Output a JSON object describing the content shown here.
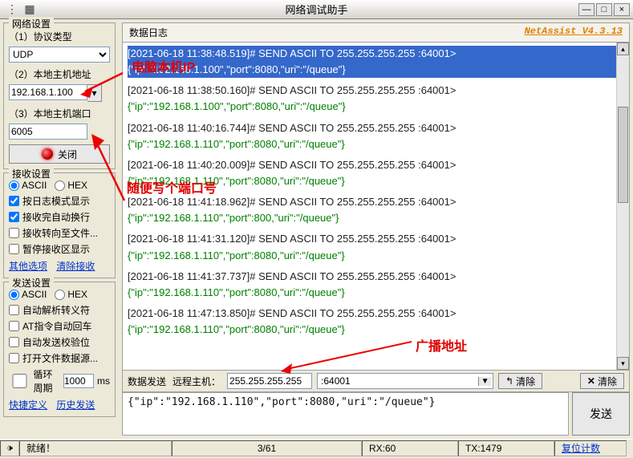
{
  "window": {
    "title": "网络调试助手",
    "brand": "NetAssist  V4.3.13"
  },
  "winbtns": {
    "min": "—",
    "max": "□",
    "close": "×"
  },
  "net_settings": {
    "title": "网络设置",
    "proto_label": "（1）协议类型",
    "proto_value": "UDP",
    "host_label": "（2）本地主机地址",
    "host_value": "192.168.1.100",
    "port_label": "（3）本地主机端口",
    "port_value": "6005",
    "btn_close": "关闭"
  },
  "recv_settings": {
    "title": "接收设置",
    "ascii": "ASCII",
    "hex": "HEX",
    "c1": "按日志模式显示",
    "c2": "接收完自动换行",
    "c3": "接收转向至文件...",
    "c4": "暂停接收区显示",
    "link_other": "其他选项",
    "link_clear": "清除接收"
  },
  "send_settings": {
    "title": "发送设置",
    "ascii": "ASCII",
    "hex": "HEX",
    "c1": "自动解析转义符",
    "c2": "AT指令自动回车",
    "c3": "自动发送校验位",
    "c4": "打开文件数据源...",
    "cycle_label": "循环周期",
    "cycle_val": "1000",
    "cycle_unit": "ms",
    "link_short": "快捷定义",
    "link_hist": "历史发送"
  },
  "log": {
    "tab": "数据日志",
    "entries": [
      {
        "t": "[2021-06-18 11:38:48.519]# SEND ASCII TO 255.255.255.255 :64001>",
        "b": "{\"ip\":\"192.168.1.100\",\"port\":8080,\"uri\":\"/queue\"}",
        "sel": true
      },
      {
        "t": "[2021-06-18 11:38:50.160]# SEND ASCII TO 255.255.255.255 :64001>",
        "b": "{\"ip\":\"192.168.1.100\",\"port\":8080,\"uri\":\"/queue\"}"
      },
      {
        "t": "[2021-06-18 11:40:16.744]# SEND ASCII TO 255.255.255.255 :64001>",
        "b": "{\"ip\":\"192.168.1.110\",\"port\":8080,\"uri\":\"/queue\"}"
      },
      {
        "t": "[2021-06-18 11:40:20.009]# SEND ASCII TO 255.255.255.255 :64001>",
        "b": "{\"ip\":\"192.168.1.110\",\"port\":8080,\"uri\":\"/queue\"}"
      },
      {
        "t": "[2021-06-18 11:41:18.962]# SEND ASCII TO 255.255.255.255 :64001>",
        "b": "{\"ip\":\"192.168.1.110\",\"port\":800,\"uri\":\"/queue\"}"
      },
      {
        "t": "[2021-06-18 11:41:31.120]# SEND ASCII TO 255.255.255.255 :64001>",
        "b": "{\"ip\":\"192.168.1.110\",\"port\":8080,\"uri\":\"/queue\"}"
      },
      {
        "t": "[2021-06-18 11:41:37.737]# SEND ASCII TO 255.255.255.255 :64001>",
        "b": "{\"ip\":\"192.168.1.110\",\"port\":8080,\"uri\":\"/queue\"}"
      },
      {
        "t": "[2021-06-18 11:47:13.850]# SEND ASCII TO 255.255.255.255 :64001>",
        "b": "{\"ip\":\"192.168.1.110\",\"port\":8080,\"uri\":\"/queue\"}"
      }
    ]
  },
  "annots": {
    "ip": "电脑本机IP",
    "port": "随便写个端口号",
    "bcast": "广播地址"
  },
  "send_panel": {
    "tab": "数据发送",
    "host_label": "远程主机：",
    "host_value": "255.255.255.255",
    "port_value": ":64001",
    "clear1": "清除",
    "clear2": "清除",
    "text": "{\"ip\":\"192.168.1.110\",\"port\":8080,\"uri\":\"/queue\"}",
    "send_btn": "发送"
  },
  "status": {
    "ready": "就绪！",
    "pos": "3/61",
    "rx": "RX:60",
    "tx": "TX:1479",
    "reset": "复位计数"
  }
}
